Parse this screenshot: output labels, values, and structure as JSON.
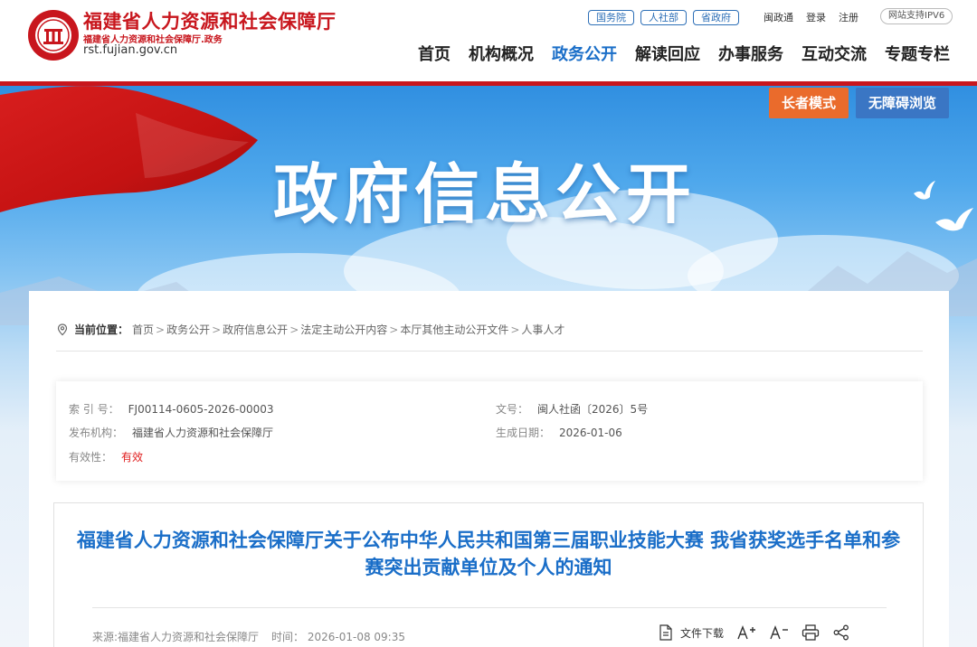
{
  "header": {
    "site_name": "福建省人力资源和社会保障厅",
    "site_subname": "福建省人力资源和社会保障厅.政务",
    "site_url": "rst.fujian.gov.cn",
    "top_pills": [
      "国务院",
      "人社部",
      "省政府"
    ],
    "top_links": [
      "闽政通",
      "登录",
      "注册"
    ],
    "ipv6_label": "网站支持IPV6",
    "nav": [
      "首页",
      "机构概况",
      "政务公开",
      "解读回应",
      "办事服务",
      "互动交流",
      "专题专栏"
    ],
    "active_nav": "政务公开",
    "brand_color": "#c8161d",
    "accent_color": "#1a6ec8"
  },
  "banner": {
    "title": "政府信息公开",
    "elder_mode": "长者模式",
    "accessible_mode": "无障碍浏览"
  },
  "breadcrumb": {
    "label": "当前位置：",
    "items": [
      "首页",
      "政务公开",
      "政府信息公开",
      "法定主动公开内容",
      "本厅其他主动公开文件",
      "人事人才"
    ],
    "separator": ">"
  },
  "meta": {
    "index_label": "索 引 号：",
    "index_value": "FJ00114-0605-2026-00003",
    "docno_label": "文号：",
    "docno_value": "闽人社函〔2026〕5号",
    "org_label": "发布机构：",
    "org_value": "福建省人力资源和社会保障厅",
    "date_label": "生成日期：",
    "date_value": "2026-01-06",
    "valid_label": "有效性：",
    "valid_value": "有效"
  },
  "document": {
    "title": "福建省人力资源和社会保障厅关于公布中华人民共和国第三届职业技能大赛 我省获奖选手名单和参赛突出贡献单位及个人的通知",
    "source": "来源:福建省人力资源和社会保障厅",
    "time": "时间：  2026-01-08 09:35",
    "download_label": "文件下载"
  },
  "icons": [
    "emblem-icon",
    "location-icon",
    "file-download-icon",
    "font-increase-icon",
    "font-decrease-icon",
    "print-icon",
    "share-icon",
    "flag-icon",
    "dove-icon"
  ]
}
